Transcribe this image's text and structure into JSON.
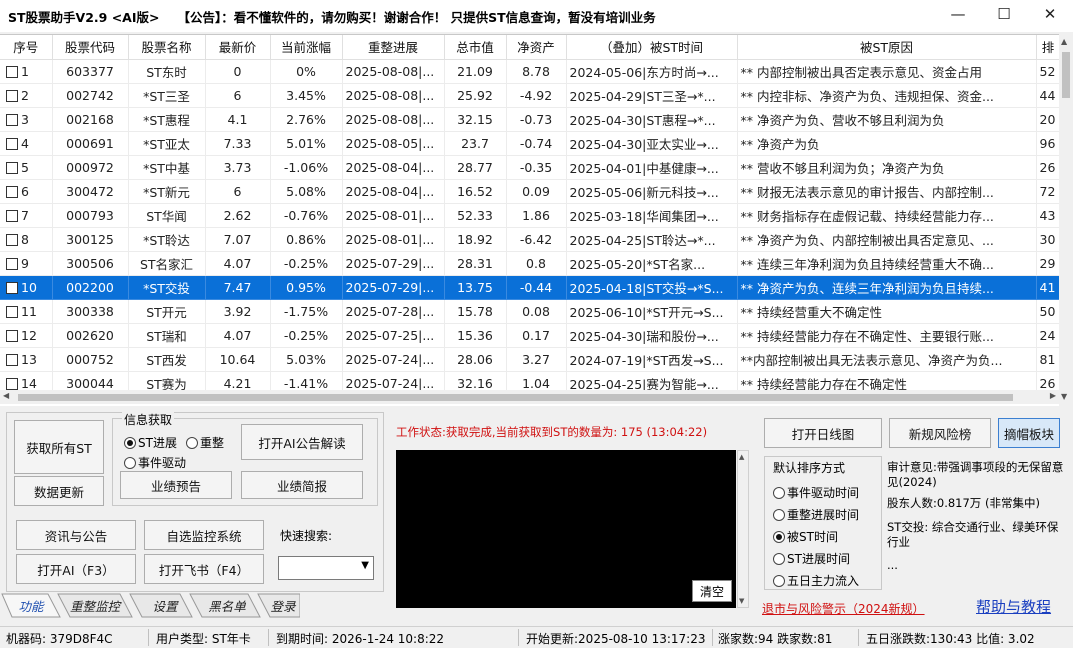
{
  "window": {
    "title": "ST股票助手V2.9 <AI版>",
    "announcement": "【公告】：看不懂软件的，请勿购买！谢谢合作！ 只提供ST信息查询，暂没有培训业务",
    "minimize": "—",
    "maximize": "☐",
    "close": "✕"
  },
  "grid": {
    "columns": [
      "序号",
      "股票代码",
      "股票名称",
      "最新价",
      "当前涨幅",
      "重整进展",
      "总市值",
      "净资产",
      "（叠加）被ST时间",
      "被ST原因",
      "排"
    ],
    "rows": [
      [
        "1",
        "603377",
        "ST东时",
        "0",
        "0%",
        "2025-08-08|...",
        "21.09",
        "8.78",
        "2024-05-06|东方时尚→...",
        "** 内部控制被出具否定表示意见、资金占用",
        "52"
      ],
      [
        "2",
        "002742",
        "*ST三圣",
        "6",
        "3.45%",
        "2025-08-08|...",
        "25.92",
        "-4.92",
        "2025-04-29|ST三圣→*...",
        "** 内控非标、净资产为负、违规担保、资金...",
        "44"
      ],
      [
        "3",
        "002168",
        "*ST惠程",
        "4.1",
        "2.76%",
        "2025-08-08|...",
        "32.15",
        "-0.73",
        "2025-04-30|ST惠程→*...",
        "** 净资产为负、营收不够且利润为负",
        "20"
      ],
      [
        "4",
        "000691",
        "*ST亚太",
        "7.33",
        "5.01%",
        "2025-08-05|...",
        "23.7",
        "-0.74",
        "2025-04-30|亚太实业→...",
        "** 净资产为负",
        "96"
      ],
      [
        "5",
        "000972",
        "*ST中基",
        "3.73",
        "-1.06%",
        "2025-08-04|...",
        "28.77",
        "-0.35",
        "2025-04-01|中基健康→...",
        "** 营收不够且利润为负；净资产为负",
        "26"
      ],
      [
        "6",
        "300472",
        "*ST新元",
        "6",
        "5.08%",
        "2025-08-04|...",
        "16.52",
        "0.09",
        "2025-05-06|新元科技→...",
        "** 财报无法表示意见的审计报告、内部控制...",
        "72"
      ],
      [
        "7",
        "000793",
        "ST华闻",
        "2.62",
        "-0.76%",
        "2025-08-01|...",
        "52.33",
        "1.86",
        "2025-03-18|华闻集团→...",
        "** 财务指标存在虚假记载、持续经营能力存...",
        "43"
      ],
      [
        "8",
        "300125",
        "*ST聆达",
        "7.07",
        "0.86%",
        "2025-08-01|...",
        "18.92",
        "-6.42",
        "2025-04-25|ST聆达→*...",
        "** 净资产为负、内部控制被出具否定意见、...",
        "30"
      ],
      [
        "9",
        "300506",
        "ST名家汇",
        "4.07",
        "-0.25%",
        "2025-07-29|...",
        "28.31",
        "0.8",
        "2025-05-20|*ST名家...",
        "** 连续三年净利润为负且持续经营重大不确...",
        "29"
      ],
      [
        "10",
        "002200",
        "*ST交投",
        "7.47",
        "0.95%",
        "2025-07-29|...",
        "13.75",
        "-0.44",
        "2025-04-18|ST交投→*S...",
        "** 净资产为负、连续三年净利润为负且持续...",
        "41"
      ],
      [
        "11",
        "300338",
        "ST开元",
        "3.92",
        "-1.75%",
        "2025-07-28|...",
        "15.78",
        "0.08",
        "2025-06-10|*ST开元→S...",
        "** 持续经营重大不确定性",
        "50"
      ],
      [
        "12",
        "002620",
        "ST瑞和",
        "4.07",
        "-0.25%",
        "2025-07-25|...",
        "15.36",
        "0.17",
        "2025-04-30|瑞和股份→...",
        "** 持续经营能力存在不确定性、主要银行账...",
        "24"
      ],
      [
        "13",
        "000752",
        "ST西发",
        "10.64",
        "5.03%",
        "2025-07-24|...",
        "28.06",
        "3.27",
        "2024-07-19|*ST西发→S...",
        "**内部控制被出具无法表示意见、净资产为负...",
        "81"
      ],
      [
        "14",
        "300044",
        "ST赛为",
        "4.21",
        "-1.41%",
        "2025-07-24|...",
        "32.16",
        "1.04",
        "2025-04-25|赛为智能→...",
        "** 持续经营能力存在不确定性",
        "26"
      ]
    ],
    "selected_row_index": 9
  },
  "panel": {
    "btn_get_all": "获取所有ST",
    "btn_update": "数据更新",
    "info_group_title": "信息获取",
    "radio_progress": "ST进展",
    "radio_reorg": "重整",
    "radio_event": "事件驱动",
    "btn_ai_announce": "打开AI公告解读",
    "btn_forecast": "业绩预告",
    "btn_brief": "业绩简报",
    "btn_news": "资讯与公告",
    "btn_monitor": "自选监控系统",
    "btn_open_ai": "打开AI（F3）",
    "btn_feishu": "打开飞书（F4）",
    "quick_search_label": "快速搜索:",
    "quick_search_value": "",
    "status_text": "工作状态:获取完成,当前获取到ST的数量为: 175 (13:04:22)",
    "btn_clear": "清空",
    "btn_daily": "打开日线图",
    "btn_risk": "新规风险榜",
    "btn_cap": "摘帽板块",
    "sort_title": "默认排序方式",
    "sort_options": [
      "事件驱动时间",
      "重整进展时间",
      "被ST时间",
      "ST进展时间",
      "五日主力流入"
    ],
    "sort_selected": 2,
    "info_audit": "审计意见:带强调事项段的无保留意见(2024)",
    "info_holders": "股东人数:0.817万 (非常集中)",
    "info_industry": "ST交投: 综合交通行业、绿美环保行业",
    "info_more": "...",
    "link_delist": "退市与风险警示（2024新规）",
    "link_help": "帮助与教程"
  },
  "tabs": [
    "功能",
    "重整监控",
    "设置",
    "黑名单",
    "登录"
  ],
  "statusbar": {
    "machine": "机器码: 379D8F4C",
    "user_type": "用户类型: ST年卡",
    "expire": "到期时间: 2026-1-24 10:8:22",
    "start_update": "开始更新:2025-08-10 13:17:23",
    "up_down": "涨家数:94  跌家数:81",
    "five_day": "五日涨跌数:130:43 比值: 3.02"
  }
}
